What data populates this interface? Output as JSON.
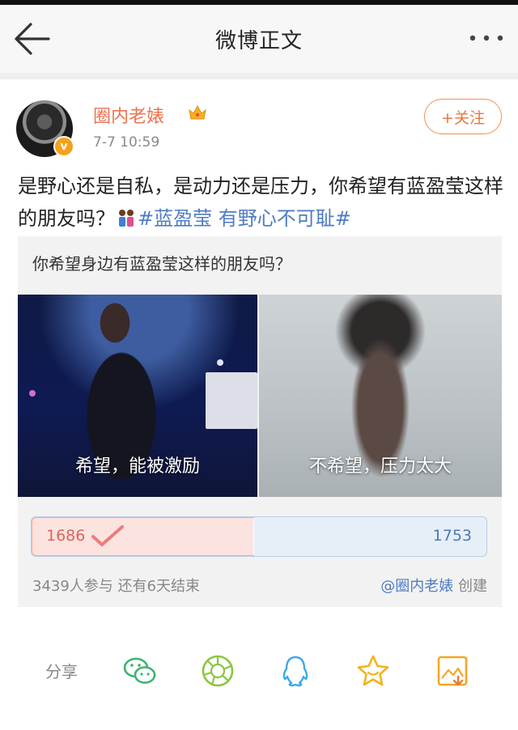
{
  "nav": {
    "title": "微博正文"
  },
  "post": {
    "username": "圈内老婊",
    "verified_badge": "v",
    "time": "7-7 10:59",
    "follow_label": "+关注",
    "text_before": "是野心还是自私，是动力还是压力，你希望有蓝盈莹这样的朋友吗？",
    "topic": "#蓝盈莹 有野心不可耻#"
  },
  "vote": {
    "question": "你希望身边有蓝盈莹这样的朋友吗？",
    "option_left": "希望，能被激励",
    "option_right": "不希望，压力太大",
    "count_left": "1686",
    "count_right": "1753",
    "share_left": 0.49,
    "stats": "3439人参与  还有6天结束",
    "creator_name": "@圈内老婊",
    "creator_suffix": " 创建"
  },
  "actions": {
    "share_label": "分享"
  },
  "colors": {
    "accent_orange": "#eb7350",
    "topic_blue": "#4f7cc3",
    "vote_left": "#e0645a",
    "vote_right": "#4d79b8"
  },
  "icons": [
    "back-arrow-icon",
    "more-dots-icon",
    "crown-icon",
    "couple-emoji-icon",
    "checkmark-icon",
    "wechat-icon",
    "moments-icon",
    "qq-icon",
    "star-icon",
    "save-image-icon"
  ]
}
